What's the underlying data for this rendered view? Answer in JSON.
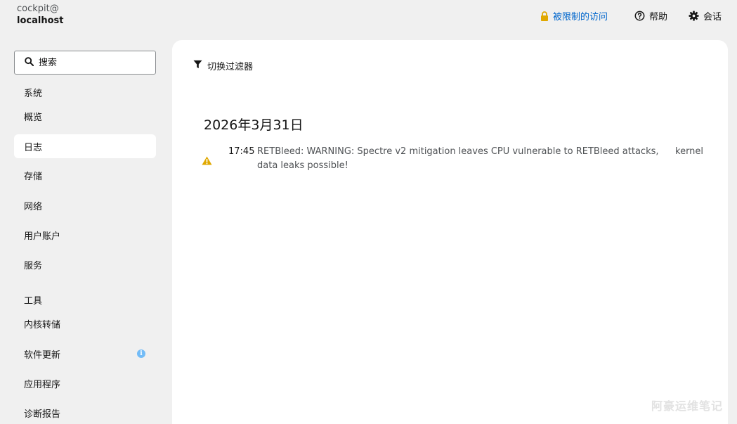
{
  "host": {
    "user": "cockpit@",
    "name": "localhost"
  },
  "header": {
    "access_label": "被限制的访问",
    "help_label": "帮助",
    "session_label": "会话",
    "accent_color": "#0066cc",
    "lock_color": "#e0a800"
  },
  "sidebar": {
    "search_placeholder": "搜索",
    "section_system": "系统",
    "system_items": [
      {
        "label": "概览"
      },
      {
        "label": "日志",
        "active": true
      },
      {
        "label": "存储"
      },
      {
        "label": "网络"
      },
      {
        "label": "用户账户"
      },
      {
        "label": "服务"
      }
    ],
    "section_tools": "工具",
    "tools_items": [
      {
        "label": "内核转储"
      },
      {
        "label": "软件更新",
        "badge": "i"
      },
      {
        "label": "应用程序"
      },
      {
        "label": "诊断报告"
      }
    ]
  },
  "main": {
    "filter_label": "切换过滤器",
    "date_heading": "2026年3月31日",
    "entries": [
      {
        "severity_icon": "warning-triangle-icon",
        "time": "17:45",
        "message": "RETBleed: WARNING: Spectre v2 mitigation leaves CPU vulnerable to RETBleed attacks, data leaks possible!",
        "identifier": "kernel"
      }
    ]
  },
  "watermark": "阿豪运维笔记"
}
